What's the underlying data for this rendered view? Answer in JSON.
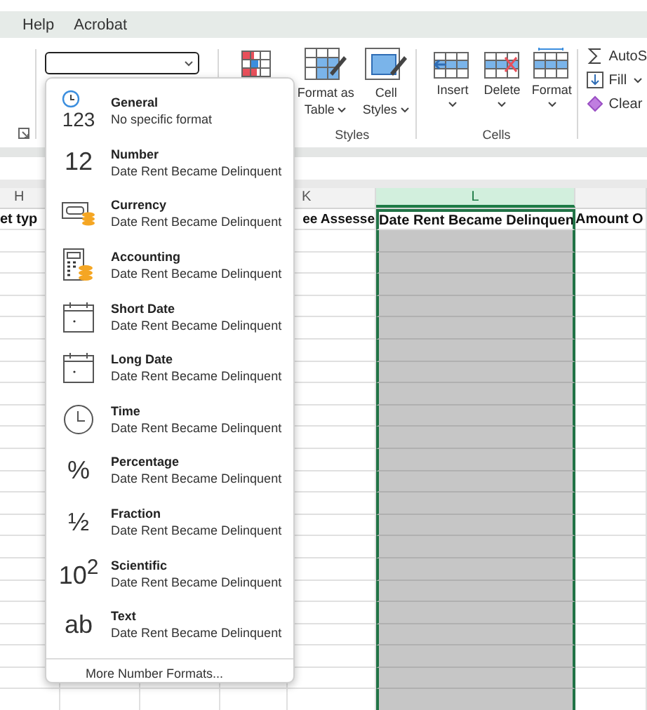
{
  "menu": [
    {
      "label": "Help"
    },
    {
      "label": "Acrobat"
    }
  ],
  "ribbon": {
    "groups": [
      {
        "kind": "styles",
        "label": "Styles",
        "commands": [
          {
            "kind": "format-table",
            "lines": [
              "Format as",
              "Table"
            ],
            "dropdown": true
          },
          {
            "kind": "cell-styles",
            "lines": [
              "Cell",
              "Styles"
            ],
            "dropdown": true
          }
        ]
      },
      {
        "kind": "cells",
        "label": "Cells",
        "commands": [
          {
            "kind": "insert",
            "lines": [
              "Insert"
            ],
            "dropdown": true
          },
          {
            "kind": "delete",
            "lines": [
              "Delete"
            ],
            "dropdown": true
          },
          {
            "kind": "format",
            "lines": [
              "Format"
            ],
            "dropdown": true
          }
        ]
      },
      {
        "kind": "editing",
        "commands": [
          {
            "kind": "autosum",
            "lines": [
              "AutoS"
            ],
            "dropdown": false
          },
          {
            "kind": "fill",
            "lines": [
              "Fill"
            ],
            "dropdown": true
          },
          {
            "kind": "clear",
            "lines": [
              "Clear"
            ],
            "dropdown": false
          }
        ]
      }
    ]
  },
  "columns": [
    {
      "letter": "H",
      "header": "et typ",
      "selected": false
    },
    {
      "letter": "K",
      "header": "ee Assesse",
      "selected": false
    },
    {
      "letter": "L",
      "header": "Date Rent Became Delinquen",
      "selected": true
    },
    {
      "header": "Amount O",
      "selected": false
    }
  ],
  "format_menu": {
    "items": [
      {
        "kind": "general",
        "icon_text": "123",
        "title": "General",
        "subtitle": "No specific format"
      },
      {
        "kind": "number",
        "icon_text": "12",
        "title": "Number",
        "subtitle": "Date Rent Became Delinquent"
      },
      {
        "kind": "currency",
        "title": "Currency",
        "subtitle": "Date Rent Became Delinquent"
      },
      {
        "kind": "accounting",
        "title": "Accounting",
        "subtitle": "Date Rent Became Delinquent"
      },
      {
        "kind": "date",
        "title": "Short Date",
        "subtitle": "Date Rent Became Delinquent"
      },
      {
        "kind": "date",
        "title": "Long Date",
        "subtitle": "Date Rent Became Delinquent"
      },
      {
        "kind": "time",
        "title": "Time",
        "subtitle": "Date Rent Became Delinquent"
      },
      {
        "kind": "glyph",
        "icon_text": "%",
        "title": "Percentage",
        "subtitle": "Date Rent Became Delinquent"
      },
      {
        "kind": "glyph",
        "icon_text": "½",
        "title": "Fraction",
        "subtitle": "Date Rent Became Delinquent"
      },
      {
        "kind": "glyph",
        "icon_text": "10$^{2}$",
        "title": "Scientific",
        "subtitle": "Date Rent Became Delinquent"
      },
      {
        "kind": "glyph",
        "icon_text": "ab",
        "title": "Text",
        "subtitle": "Date Rent Became Delinquent"
      }
    ],
    "footer": "More Number Formats..."
  }
}
